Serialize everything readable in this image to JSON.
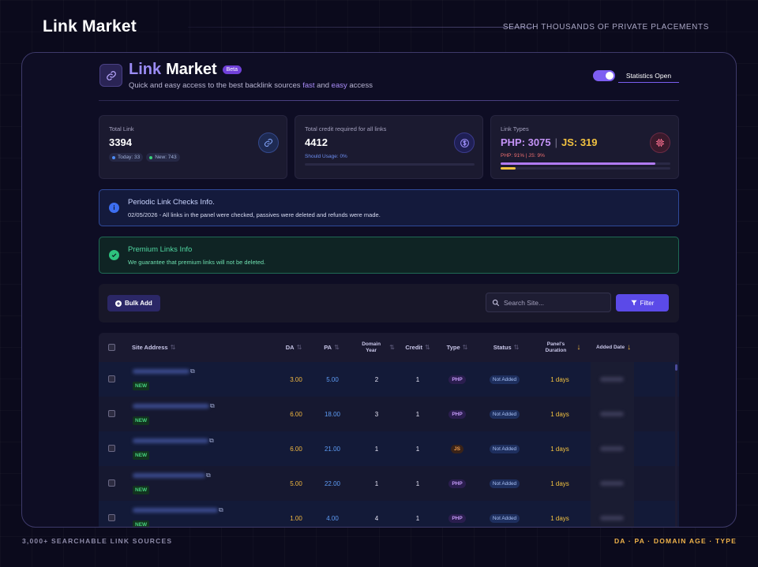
{
  "page": {
    "title": "Link Market",
    "tagline": "SEARCH THOUSANDS OF PRIVATE PLACEMENTS",
    "footer_left": "3,000+ SEARCHABLE LINK SOURCES",
    "footer_right": "DA · PA · DOMAIN AGE · TYPE"
  },
  "colors": {
    "accent": "#7d5ef2",
    "background": "#0b0a1c",
    "gold": "#f2c240",
    "blue": "#5e9cf5",
    "green": "#46d27e"
  },
  "header": {
    "title_part1": "Link",
    "title_part2": "Market",
    "beta": "Beta",
    "subtitle_a": "Quick and easy access to the best backlink sources ",
    "subtitle_fast": "fast",
    "subtitle_and": " and ",
    "subtitle_easy": "easy",
    "subtitle_b": " access",
    "logo_icon": "link-icon",
    "stats_toggle_on": true,
    "stats_label": "Statistics Open"
  },
  "cards": {
    "total_link": {
      "label": "Total Link",
      "value": "3394",
      "today": "Today: 33",
      "new": "New: 743",
      "icon": "link-icon"
    },
    "credit": {
      "label": "Total credit required for all links",
      "value": "4412",
      "usage": "Should Usage: 0%",
      "usage_fraction": 0,
      "icon": "dollar-icon"
    },
    "types": {
      "label": "Link Types",
      "php_label": "PHP: 3075",
      "sep": "|",
      "js_label": "JS: 319",
      "pct_label": "PHP: 91% | JS: 9%",
      "php_fraction": 0.91,
      "js_fraction": 0.09,
      "icon": "chip-icon"
    }
  },
  "info": {
    "periodic": {
      "title": "Periodic Link Checks Info.",
      "text": "02/05/2026 - All links in the panel were checked, passives were deleted and refunds were made.",
      "icon": "info-icon"
    },
    "premium": {
      "title": "Premium Links Info",
      "text": "We guarantee that premium links will not be deleted.",
      "icon": "check-circle-icon"
    }
  },
  "toolbar": {
    "bulk_add": "Bulk Add",
    "search_placeholder": "Search Site...",
    "filter": "Filter"
  },
  "table": {
    "columns": {
      "site": "Site Address",
      "da": "DA",
      "pa": "PA",
      "domain_year_1": "Domain",
      "domain_year_2": "Year",
      "credit": "Credit",
      "type": "Type",
      "status": "Status",
      "duration_1": "Panel's",
      "duration_2": "Duration",
      "added": "Added Date"
    },
    "rows": [
      {
        "badge": "NEW",
        "da": "3.00",
        "pa": "5.00",
        "year": "2",
        "credit": "1",
        "type": "PHP",
        "status": "Not Added",
        "duration": "1 days"
      },
      {
        "badge": "NEW",
        "da": "6.00",
        "pa": "18.00",
        "year": "3",
        "credit": "1",
        "type": "PHP",
        "status": "Not Added",
        "duration": "1 days"
      },
      {
        "badge": "NEW",
        "da": "6.00",
        "pa": "21.00",
        "year": "1",
        "credit": "1",
        "type": "JS",
        "status": "Not Added",
        "duration": "1 days"
      },
      {
        "badge": "NEW",
        "da": "5.00",
        "pa": "22.00",
        "year": "1",
        "credit": "1",
        "type": "PHP",
        "status": "Not Added",
        "duration": "1 days"
      },
      {
        "badge": "NEW",
        "da": "1.00",
        "pa": "4.00",
        "year": "4",
        "credit": "1",
        "type": "PHP",
        "status": "Not Added",
        "duration": "1 days"
      }
    ]
  }
}
